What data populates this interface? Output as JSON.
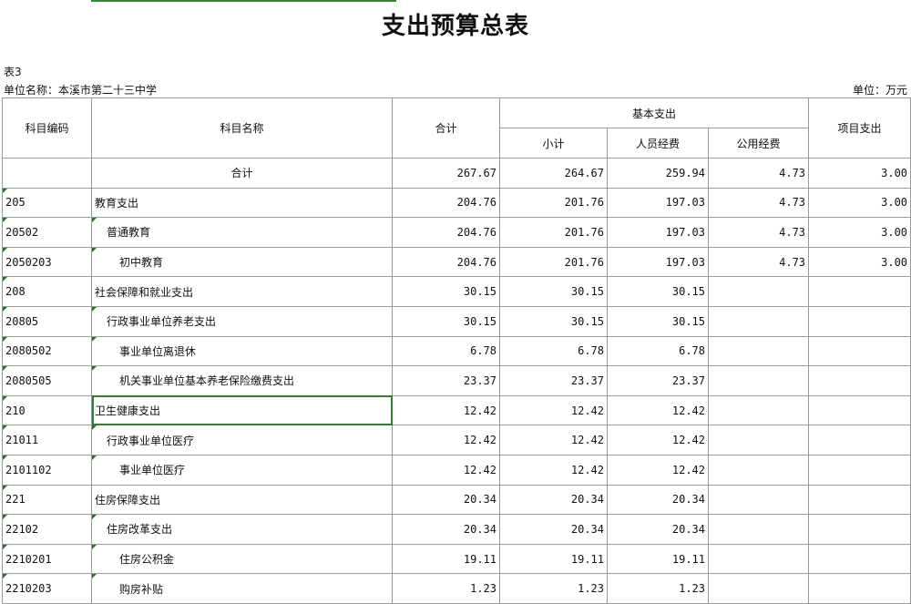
{
  "title": "支出预算总表",
  "table_no": "表3",
  "unit_name": "单位名称：本溪市第二十三中学",
  "unit": "单位：万元",
  "headers": {
    "code": "科目编码",
    "name": "科目名称",
    "total": "合计",
    "basic": "基本支出",
    "subtotal": "小计",
    "personnel": "人员经费",
    "public": "公用经费",
    "project": "项目支出"
  },
  "rows": [
    {
      "code": "",
      "name": "合计",
      "level": 0,
      "total": "267.67",
      "subtotal": "264.67",
      "personnel": "259.94",
      "public": "4.73",
      "project": "3.00"
    },
    {
      "code": "205",
      "name": "教育支出",
      "level": 1,
      "total": "204.76",
      "subtotal": "201.76",
      "personnel": "197.03",
      "public": "4.73",
      "project": "3.00"
    },
    {
      "code": "20502",
      "name": "普通教育",
      "level": 2,
      "total": "204.76",
      "subtotal": "201.76",
      "personnel": "197.03",
      "public": "4.73",
      "project": "3.00"
    },
    {
      "code": "2050203",
      "name": "初中教育",
      "level": 3,
      "total": "204.76",
      "subtotal": "201.76",
      "personnel": "197.03",
      "public": "4.73",
      "project": "3.00"
    },
    {
      "code": "208",
      "name": "社会保障和就业支出",
      "level": 1,
      "total": "30.15",
      "subtotal": "30.15",
      "personnel": "30.15",
      "public": "",
      "project": ""
    },
    {
      "code": "20805",
      "name": "行政事业单位养老支出",
      "level": 2,
      "total": "30.15",
      "subtotal": "30.15",
      "personnel": "30.15",
      "public": "",
      "project": ""
    },
    {
      "code": "2080502",
      "name": "事业单位离退休",
      "level": 3,
      "total": "6.78",
      "subtotal": "6.78",
      "personnel": "6.78",
      "public": "",
      "project": ""
    },
    {
      "code": "2080505",
      "name": "机关事业单位基本养老保险缴费支出",
      "level": 3,
      "total": "23.37",
      "subtotal": "23.37",
      "personnel": "23.37",
      "public": "",
      "project": ""
    },
    {
      "code": "210",
      "name": "卫生健康支出",
      "level": 1,
      "total": "12.42",
      "subtotal": "12.42",
      "personnel": "12.42",
      "public": "",
      "project": "",
      "selected": true
    },
    {
      "code": "21011",
      "name": "行政事业单位医疗",
      "level": 2,
      "total": "12.42",
      "subtotal": "12.42",
      "personnel": "12.42",
      "public": "",
      "project": ""
    },
    {
      "code": "2101102",
      "name": "事业单位医疗",
      "level": 3,
      "total": "12.42",
      "subtotal": "12.42",
      "personnel": "12.42",
      "public": "",
      "project": ""
    },
    {
      "code": "221",
      "name": "住房保障支出",
      "level": 1,
      "total": "20.34",
      "subtotal": "20.34",
      "personnel": "20.34",
      "public": "",
      "project": ""
    },
    {
      "code": "22102",
      "name": "住房改革支出",
      "level": 2,
      "total": "20.34",
      "subtotal": "20.34",
      "personnel": "20.34",
      "public": "",
      "project": ""
    },
    {
      "code": "2210201",
      "name": "住房公积金",
      "level": 3,
      "total": "19.11",
      "subtotal": "19.11",
      "personnel": "19.11",
      "public": "",
      "project": ""
    },
    {
      "code": "2210203",
      "name": "购房补贴",
      "level": 3,
      "total": "1.23",
      "subtotal": "1.23",
      "personnel": "1.23",
      "public": "",
      "project": ""
    }
  ]
}
